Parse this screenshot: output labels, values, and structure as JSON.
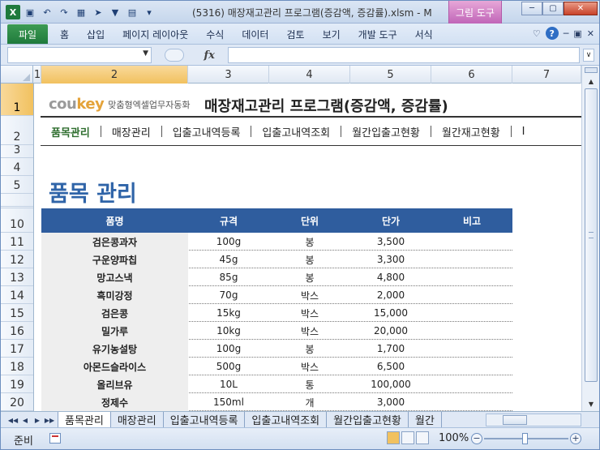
{
  "window": {
    "title": "(5316) 매장재고관리 프로그램(증감액, 증감률).xlsm - M",
    "context_tab": "그림 도구",
    "qat_icons": [
      "excel-icon",
      "save-icon",
      "undo-icon",
      "redo-icon",
      "table-icon",
      "pointer-icon",
      "filter-icon",
      "form-icon",
      "customize-icon"
    ]
  },
  "ribbon": {
    "file_tab": "파일",
    "tabs": [
      "홈",
      "삽입",
      "페이지 레이아웃",
      "수식",
      "데이터",
      "검토",
      "보기",
      "개발 도구",
      "서식"
    ]
  },
  "formula_bar": {
    "name_box": "",
    "fx": "fx",
    "formula": ""
  },
  "columns": [
    "1",
    "2",
    "3",
    "4",
    "5",
    "6",
    "7"
  ],
  "rows": [
    "1",
    "2",
    "3",
    "4",
    "5",
    "",
    "10",
    "11",
    "12",
    "13",
    "14",
    "15",
    "16",
    "17",
    "18",
    "19",
    "20"
  ],
  "header": {
    "logo_brand_a": "cou",
    "logo_brand_b": "key",
    "logo_tagline": "맞춤형엑셀업무자동화",
    "app_title": "매장재고관리 프로그램(증감액, 증감률)"
  },
  "nav": [
    "품목관리",
    "매장관리",
    "입출고내역등록",
    "입출고내역조회",
    "월간입출고현황",
    "월간재고현황",
    "I"
  ],
  "page_title": "품목 관리",
  "table": {
    "headers": [
      "품명",
      "규격",
      "단위",
      "단가",
      "비고"
    ],
    "rows": [
      [
        "검은콩과자",
        "100g",
        "봉",
        "3,500",
        ""
      ],
      [
        "구운양파칩",
        "45g",
        "봉",
        "3,300",
        ""
      ],
      [
        "망고스낵",
        "85g",
        "봉",
        "4,800",
        ""
      ],
      [
        "흑미강정",
        "70g",
        "박스",
        "2,000",
        ""
      ],
      [
        "검은콩",
        "15kg",
        "박스",
        "15,000",
        ""
      ],
      [
        "밀가루",
        "10kg",
        "박스",
        "20,000",
        ""
      ],
      [
        "유기농설탕",
        "100g",
        "봉",
        "1,700",
        ""
      ],
      [
        "아몬드슬라이스",
        "500g",
        "박스",
        "6,500",
        ""
      ],
      [
        "올리브유",
        "10L",
        "통",
        "100,000",
        ""
      ],
      [
        "정제수",
        "150ml",
        "개",
        "3,000",
        ""
      ]
    ]
  },
  "sheet_tabs": [
    "품목관리",
    "매장관리",
    "입출고내역등록",
    "입출고내역조회",
    "월간입출고현황",
    "월간"
  ],
  "status": {
    "ready": "준비",
    "zoom": "100%"
  }
}
